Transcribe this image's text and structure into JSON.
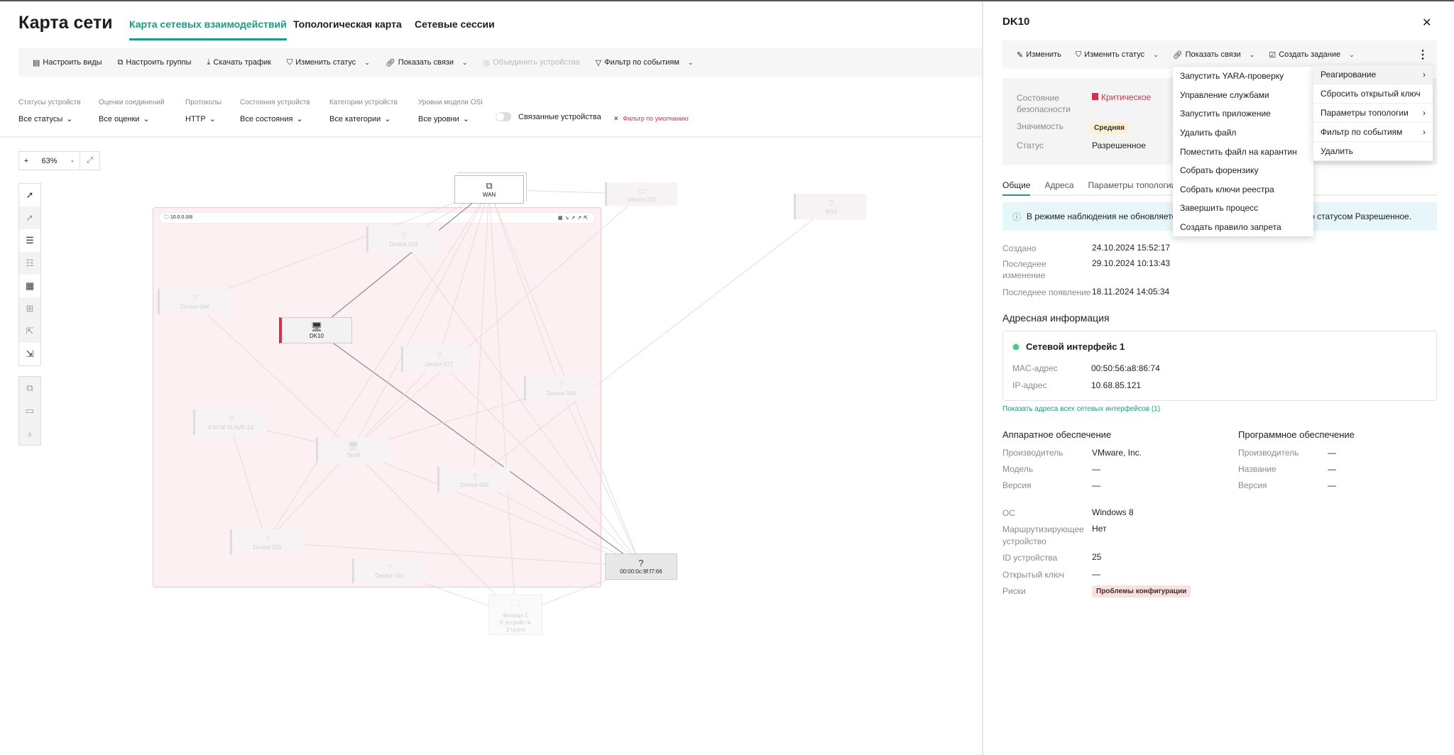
{
  "header": {
    "title": "Карта сети",
    "tabs": [
      "Карта сетевых взаимодействий",
      "Топологическая карта",
      "Сетевые сессии"
    ]
  },
  "toolbar": {
    "items": [
      {
        "label": "Настроить виды",
        "icon": "views-icon",
        "dropdown": false,
        "disabled": false
      },
      {
        "label": "Настроить группы",
        "icon": "groups-icon",
        "dropdown": false,
        "disabled": false
      },
      {
        "label": "Скачать трафик",
        "icon": "download-icon",
        "dropdown": false,
        "disabled": false
      },
      {
        "label": "Изменить статус",
        "icon": "shield-icon",
        "dropdown": true,
        "disabled": false
      },
      {
        "label": "Показать связи",
        "icon": "link-icon",
        "dropdown": true,
        "disabled": false
      },
      {
        "label": "Объединить устройства",
        "icon": "merge-icon",
        "dropdown": false,
        "disabled": true
      },
      {
        "label": "Фильтр по событиям",
        "icon": "filter-icon",
        "dropdown": true,
        "disabled": false
      }
    ]
  },
  "filters": [
    {
      "label": "Статусы устройств",
      "value": "Все статусы"
    },
    {
      "label": "Оценки соединений",
      "value": "Все оценки"
    },
    {
      "label": "Протоколы",
      "value": "HTTP"
    },
    {
      "label": "Состояния устройств",
      "value": "Все состояния"
    },
    {
      "label": "Категории устройств",
      "value": "Все категории"
    },
    {
      "label": "Уровни модели OSI",
      "value": "Все уровни"
    }
  ],
  "linked_toggle": {
    "label": "Связанные устройства",
    "on": false
  },
  "reset_filter": "Фильтр по умолчанию",
  "zoom": {
    "plus": "+",
    "value": "63%",
    "minus": "-"
  },
  "map": {
    "group_label": "10.0.0.0/8",
    "nodes": [
      {
        "label": "WAN",
        "icon": "⧉",
        "kind": "wan"
      },
      {
        "label": "Device 035",
        "icon": "▭",
        "kind": "faded"
      },
      {
        "label": "W10",
        "icon": "?",
        "kind": "faded"
      },
      {
        "label": "Device 022",
        "icon": "?",
        "kind": "faded"
      },
      {
        "label": "Device 044",
        "icon": "?",
        "kind": "faded"
      },
      {
        "label": "DK10",
        "icon": "🖥",
        "kind": "selected"
      },
      {
        "label": "Device 077",
        "icon": "?",
        "kind": "faded"
      },
      {
        "label": "Device 016",
        "icon": "?",
        "kind": "faded"
      },
      {
        "label": "KSCW-SLAVE-14",
        "icon": "?",
        "kind": "faded"
      },
      {
        "label": "Test4",
        "icon": "🖥",
        "kind": "faded"
      },
      {
        "label": "Device 092",
        "icon": "?",
        "kind": "faded"
      },
      {
        "label": "Device 020",
        "icon": "?",
        "kind": "faded"
      },
      {
        "label": "Device 010",
        "icon": "?",
        "kind": "faded"
      },
      {
        "label": "00:00:0c:9f:f7:66",
        "icon": "?",
        "kind": "dark"
      },
      {
        "label": "Филиал 1\n0 устройств\n3 групп",
        "icon": "🗀",
        "kind": "faded"
      }
    ],
    "edges": [
      [
        0,
        5,
        1
      ],
      [
        5,
        13,
        1
      ],
      [
        0,
        3,
        0
      ],
      [
        0,
        6,
        0
      ],
      [
        0,
        7,
        0
      ],
      [
        0,
        9,
        0
      ],
      [
        0,
        10,
        0
      ],
      [
        0,
        13,
        0
      ],
      [
        0,
        1,
        0
      ],
      [
        0,
        4,
        0
      ],
      [
        0,
        14,
        0
      ],
      [
        0,
        11,
        0
      ],
      [
        2,
        10,
        0
      ],
      [
        1,
        9,
        0
      ],
      [
        9,
        13,
        0
      ],
      [
        9,
        11,
        0
      ],
      [
        9,
        14,
        0
      ],
      [
        4,
        9,
        0
      ],
      [
        8,
        9,
        0
      ],
      [
        8,
        11,
        0
      ],
      [
        11,
        13,
        0
      ],
      [
        6,
        13,
        0
      ],
      [
        7,
        13,
        0
      ],
      [
        3,
        13,
        0
      ],
      [
        12,
        14,
        0
      ],
      [
        13,
        14,
        0
      ],
      [
        10,
        13,
        0
      ],
      [
        6,
        9,
        0
      ],
      [
        7,
        9,
        0
      ]
    ]
  },
  "panel": {
    "title": "DK10",
    "toolbar": [
      {
        "label": "Изменить",
        "icon": "pencil-icon"
      },
      {
        "label": "Изменить статус",
        "icon": "shield-icon"
      },
      {
        "label": "Показать связи",
        "icon": "link-icon"
      },
      {
        "label": "Создать задание",
        "icon": "clipboard-icon"
      }
    ],
    "summary": [
      {
        "label": "Состояние безопасности",
        "value": "Критическое",
        "color": "#d1344a"
      },
      {
        "label": "Значимость",
        "value": "Средняя"
      },
      {
        "label": "Статус",
        "value": "Разрешенное"
      }
    ],
    "tabs": [
      "Общие",
      "Адреса",
      "Параметры топологии"
    ],
    "banner_left": "В режиме наблюдения не обновляется",
    "banner_right": "со статусом Разрешенное.",
    "dates": [
      {
        "label": "Создано",
        "value": "24.10.2024 15:52:17"
      },
      {
        "label": "Последнее изменение",
        "value": "29.10.2024 10:13:43"
      },
      {
        "label": "Последнее появление",
        "value": "18.11.2024 14:05:34"
      }
    ],
    "address_title": "Адресная информация",
    "interface": {
      "name": "Сетевой интерфейс 1",
      "mac_label": "MAC-адрес",
      "mac": "00:50:56:a8:86:74",
      "ip_label": "IP-адрес",
      "ip": "10.68.85.121"
    },
    "show_all_link": "Показать адреса всех сетевых интерфейсов (1)",
    "hardware": {
      "title": "Аппаратное обеспечение",
      "rows": [
        {
          "label": "Производитель",
          "value": "VMware, Inc."
        },
        {
          "label": "Модель",
          "value": "—"
        },
        {
          "label": "Версия",
          "value": "—"
        }
      ]
    },
    "software": {
      "title": "Программное обеспечение",
      "rows": [
        {
          "label": "Производитель",
          "value": "—"
        },
        {
          "label": "Название",
          "value": "—"
        },
        {
          "label": "Версия",
          "value": "—"
        }
      ]
    },
    "other": [
      {
        "label": "ОС",
        "value": "Windows 8"
      },
      {
        "label": "Маршрутизирующее устройство",
        "value": "Нет"
      },
      {
        "label": "ID устройства",
        "value": "25"
      },
      {
        "label": "Открытый ключ",
        "value": "—"
      },
      {
        "label": "Риски",
        "value": "Проблемы конфигурации"
      }
    ],
    "menu": [
      "Запустить YARA-проверку",
      "Управление службами",
      "Запустить приложение",
      "Удалить файл",
      "Поместить файл на карантин",
      "Собрать форензику",
      "Собрать ключи реестра",
      "Завершить процесс",
      "Создать правило запрета"
    ],
    "more_menu": [
      {
        "label": "Реагирование",
        "sub": true
      },
      {
        "label": "Сбросить открытый ключ",
        "sub": false
      },
      {
        "label": "Параметры топологии",
        "sub": true
      },
      {
        "label": "Фильтр по событиям",
        "sub": true
      },
      {
        "label": "Удалить",
        "sub": false
      }
    ]
  },
  "colors": {
    "accent": "#1d9a82",
    "critical": "#d1344a",
    "medium_badge": "#fdf0d5",
    "risk_badge": "#fbe0e0"
  }
}
